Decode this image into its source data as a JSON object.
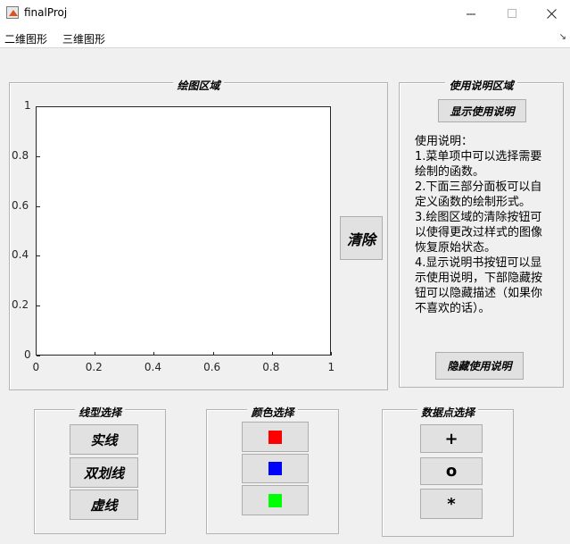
{
  "window": {
    "title": "finalProj",
    "minimize_icon": "minimize-icon",
    "maximize_icon": "maximize-icon",
    "close_icon": "close-icon"
  },
  "menubar": {
    "items": [
      "二维图形",
      "三维图形"
    ],
    "overflow_icon": "chevron-down-icon"
  },
  "plot_panel": {
    "title": "绘图区域",
    "clear_button": "清除",
    "axes": {
      "x_ticks": [
        "0",
        "0.2",
        "0.4",
        "0.6",
        "0.8",
        "1"
      ],
      "y_ticks": [
        "0",
        "0.2",
        "0.4",
        "0.6",
        "0.8",
        "1"
      ],
      "xlim": [
        0,
        1
      ],
      "ylim": [
        0,
        1
      ]
    }
  },
  "help_panel": {
    "title": "使用说明区域",
    "show_button": "显示使用说明",
    "hide_button": "隐藏使用说明",
    "text": "使用说明：\n1.菜单项中可以选择需要绘制的函数。\n2.下面三部分面板可以自定义函数的绘制形式。\n3.绘图区域的清除按钮可以使得更改过样式的图像恢复原始状态。\n4.显示说明书按钮可以显示使用说明，下部隐藏按钮可以隐藏描述（如果你不喜欢的话）。"
  },
  "line_panel": {
    "title": "线型选择",
    "buttons": [
      "实线",
      "双划线",
      "虚线"
    ]
  },
  "color_panel": {
    "title": "颜色选择",
    "colors": [
      "#ff0000",
      "#0000ff",
      "#00ff00"
    ]
  },
  "marker_panel": {
    "title": "数据点选择",
    "buttons": [
      "+",
      "o",
      "*"
    ]
  }
}
